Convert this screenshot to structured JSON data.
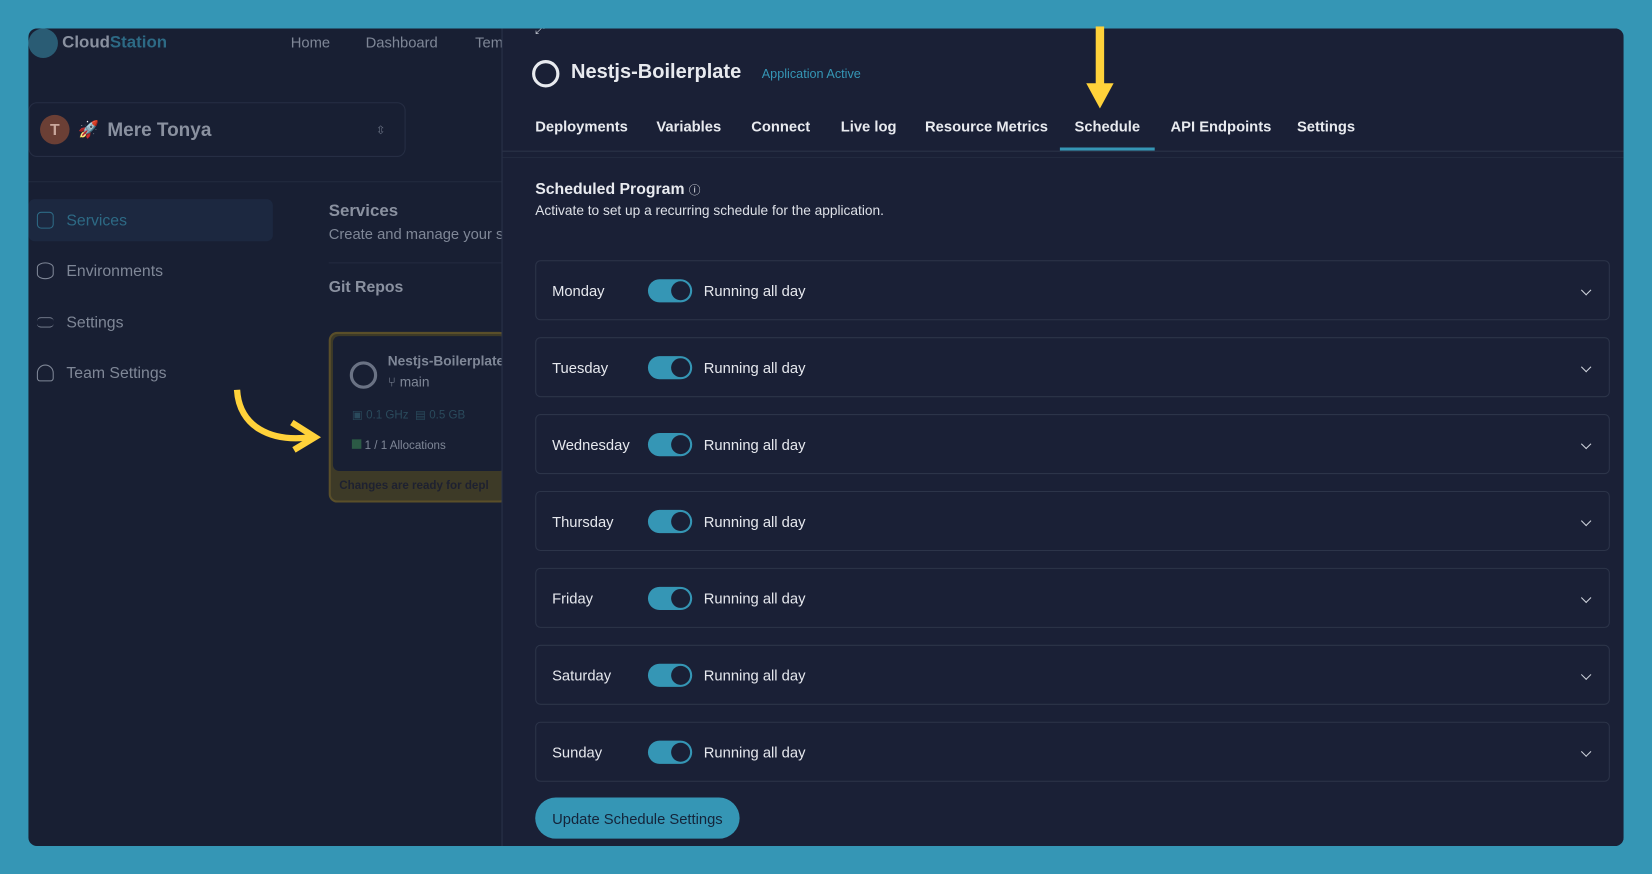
{
  "brand": {
    "name_a": "Cloud",
    "name_b": "Station"
  },
  "topnav": [
    "Home",
    "Dashboard",
    "Tem"
  ],
  "team": {
    "initial": "T",
    "name": "Mere Tonya"
  },
  "sidebar": [
    {
      "label": "Services",
      "active": true
    },
    {
      "label": "Environments"
    },
    {
      "label": "Settings"
    },
    {
      "label": "Team Settings"
    }
  ],
  "services": {
    "title": "Services",
    "subtitle": "Create and manage your s",
    "git_repos": "Git Repos"
  },
  "repo_card": {
    "name": "Nestjs-Boilerplate",
    "branch": "main",
    "cpu": "0.1 GHz",
    "memory": "0.5 GB",
    "allocations": "1 / 1 Allocations",
    "footer": "Changes are ready for depl"
  },
  "panel": {
    "title": "Nestjs-Boilerplate",
    "status": "Application Active",
    "tabs": [
      "Deployments",
      "Variables",
      "Connect",
      "Live log",
      "Resource Metrics",
      "Schedule",
      "API Endpoints",
      "Settings"
    ],
    "active_tab": "Schedule",
    "section_title": "Scheduled Program",
    "section_subtitle": "Activate to set up a recurring schedule for the application.",
    "days": [
      {
        "day": "Monday",
        "enabled": true,
        "status": "Running all day"
      },
      {
        "day": "Tuesday",
        "enabled": true,
        "status": "Running all day"
      },
      {
        "day": "Wednesday",
        "enabled": true,
        "status": "Running all day"
      },
      {
        "day": "Thursday",
        "enabled": true,
        "status": "Running all day"
      },
      {
        "day": "Friday",
        "enabled": true,
        "status": "Running all day"
      },
      {
        "day": "Saturday",
        "enabled": true,
        "status": "Running all day"
      },
      {
        "day": "Sunday",
        "enabled": true,
        "status": "Running all day"
      }
    ],
    "update_button": "Update Schedule Settings"
  },
  "colors": {
    "accent": "#3596b5",
    "annotation": "#ffd23a",
    "background": "#181f33"
  }
}
